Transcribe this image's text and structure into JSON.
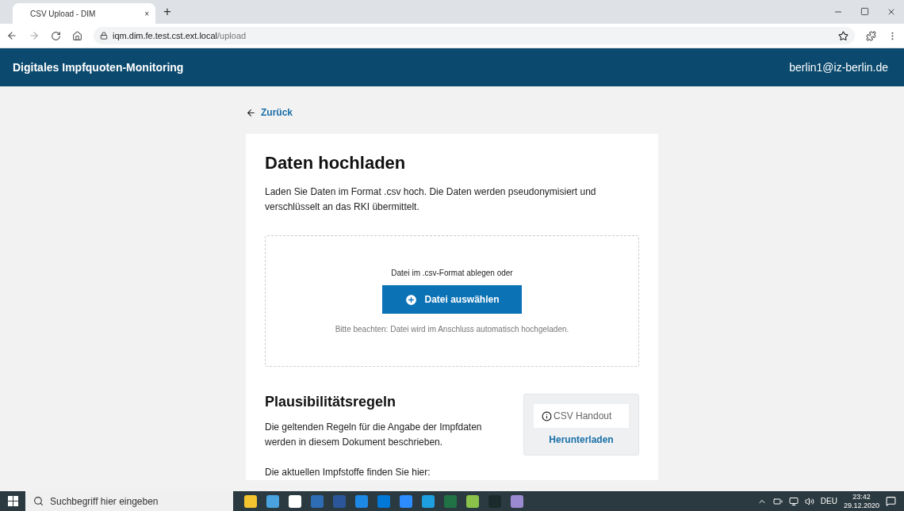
{
  "browser": {
    "tab_title": "CSV Upload - DIM",
    "tab_close": "×",
    "new_tab": "+",
    "url_host": "iqm.dim.fe.test.cst.ext.local",
    "url_path": "/upload"
  },
  "header": {
    "title": "Digitales Impfquoten-Monitoring",
    "user": "berlin1@iz-berlin.de"
  },
  "back_link": "Zurück",
  "upload": {
    "title": "Daten hochladen",
    "description": "Laden Sie Daten im Format .csv hoch. Die Daten werden pseudonymisiert und verschlüsselt an das RKI übermittelt.",
    "drop_hint": "Datei im .csv-Format ablegen oder",
    "button": "Datei auswählen",
    "note": "Bitte beachten: Datei wird im Anschluss automatisch hochgeladen."
  },
  "rules": {
    "title": "Plausibilitätsregeln",
    "description": "Die geltenden Regeln für die Angabe der Impfdaten werden in diesem Dokument beschrieben.",
    "file_label": "CSV Handout",
    "download": "Herunterladen",
    "next_text": "Die aktuellen Impfstoffe finden Sie hier:"
  },
  "taskbar": {
    "search_placeholder": "Suchbegriff hier eingeben",
    "language": "DEU",
    "time": "23:42",
    "date": "29.12.2020"
  }
}
